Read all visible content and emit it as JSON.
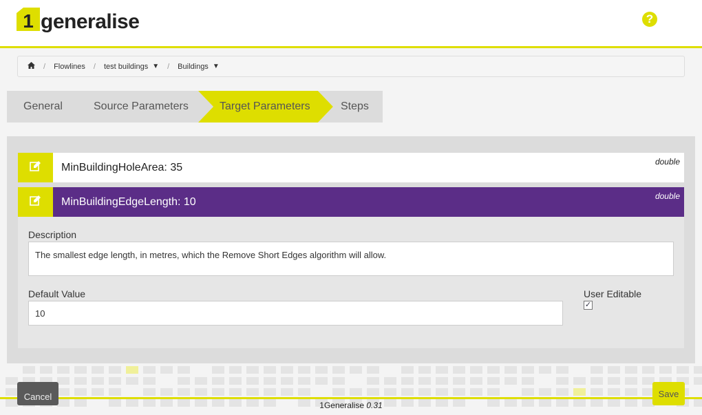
{
  "brand": {
    "logo_text": "generalise",
    "logo_digit": "1"
  },
  "header": {
    "help_glyph": "?"
  },
  "breadcrumb": {
    "items": [
      {
        "label": "Flowlines",
        "has_dropdown": false
      },
      {
        "label": "test buildings",
        "has_dropdown": true
      },
      {
        "label": "Buildings",
        "has_dropdown": true
      }
    ],
    "separator": "/",
    "caret": "▼"
  },
  "tabs": [
    {
      "label": "General",
      "active": false
    },
    {
      "label": "Source Parameters",
      "active": false
    },
    {
      "label": "Target Parameters",
      "active": true
    },
    {
      "label": "Steps",
      "active": false
    }
  ],
  "parameters": [
    {
      "name": "MinBuildingHoleArea",
      "value": "35",
      "type": "double",
      "expanded": false
    },
    {
      "name": "MinBuildingEdgeLength",
      "value": "10",
      "type": "double",
      "expanded": true
    }
  ],
  "details": {
    "description_label": "Description",
    "description_value": "The smallest edge length, in metres, which the Remove Short Edges algorithm will allow.",
    "default_label": "Default Value",
    "default_value": "10",
    "user_editable_label": "User Editable",
    "user_editable_checked": true
  },
  "actions": {
    "cancel_label": "Cancel",
    "save_label": "Save"
  },
  "footer": {
    "product": "1Generalise",
    "version": "0.31"
  },
  "colors": {
    "accent": "#dede00",
    "selected_row": "#5b2d87",
    "tab_inactive": "#dcdcdc",
    "panel": "#dcdcdc"
  }
}
